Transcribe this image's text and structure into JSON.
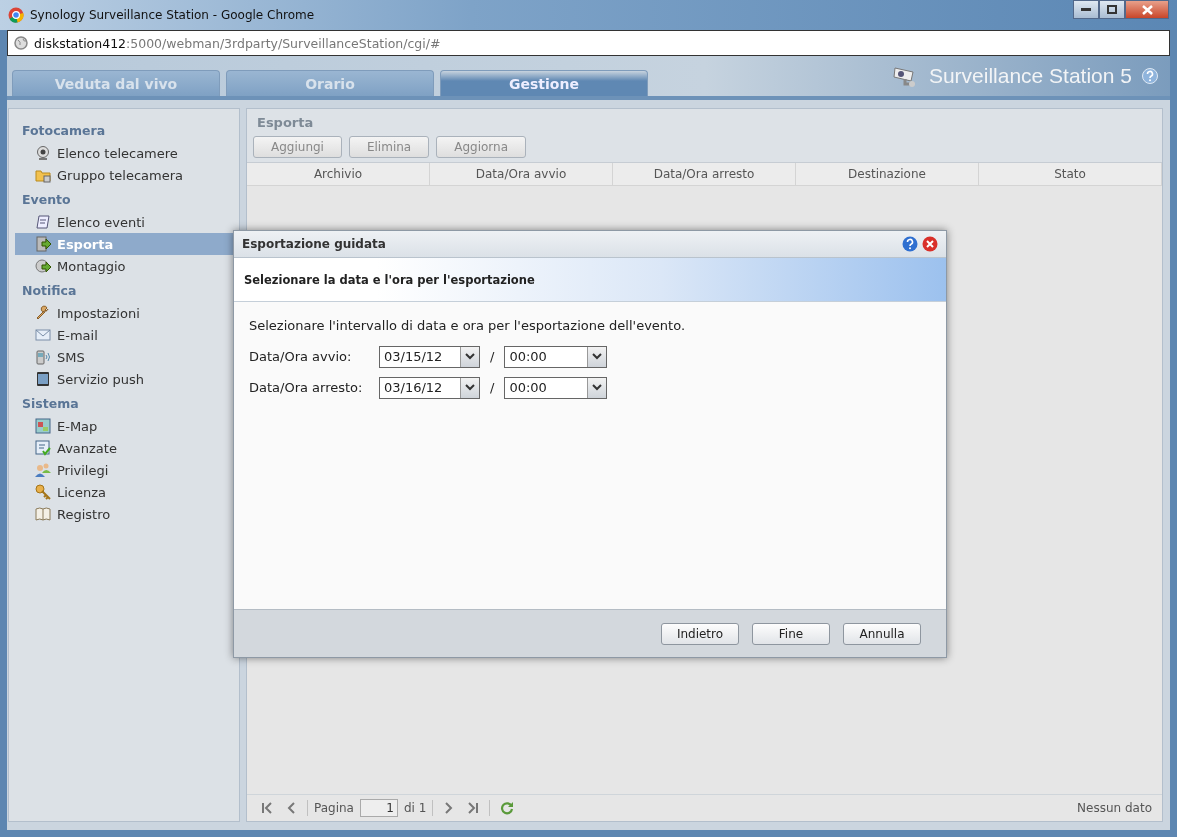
{
  "browser": {
    "title": "Synology Surveillance Station - Google Chrome",
    "url_host": "diskstation412",
    "url_rest": ":5000/webman/3rdparty/SurveillanceStation/cgi/#"
  },
  "tabs": [
    {
      "label": "Veduta dal vivo",
      "selected": false
    },
    {
      "label": "Orario",
      "selected": false
    },
    {
      "label": "Gestione",
      "selected": true
    }
  ],
  "brand": "Surveillance Station 5",
  "sidebar": {
    "groups": [
      {
        "title": "Fotocamera",
        "items": [
          {
            "label": "Elenco telecamere",
            "selected": false
          },
          {
            "label": "Gruppo telecamera",
            "selected": false
          }
        ]
      },
      {
        "title": "Evento",
        "items": [
          {
            "label": "Elenco eventi",
            "selected": false
          },
          {
            "label": "Esporta",
            "selected": true
          },
          {
            "label": "Montaggio",
            "selected": false
          }
        ]
      },
      {
        "title": "Notifica",
        "items": [
          {
            "label": "Impostazioni",
            "selected": false
          },
          {
            "label": "E-mail",
            "selected": false
          },
          {
            "label": "SMS",
            "selected": false
          },
          {
            "label": "Servizio push",
            "selected": false
          }
        ]
      },
      {
        "title": "Sistema",
        "items": [
          {
            "label": "E-Map",
            "selected": false
          },
          {
            "label": "Avanzate",
            "selected": false
          },
          {
            "label": "Privilegi",
            "selected": false
          },
          {
            "label": "Licenza",
            "selected": false
          },
          {
            "label": "Registro",
            "selected": false
          }
        ]
      }
    ]
  },
  "panel": {
    "title": "Esporta",
    "toolbar": [
      {
        "label": "Aggiungi",
        "disabled": true
      },
      {
        "label": "Elimina",
        "disabled": true
      },
      {
        "label": "Aggiorna",
        "disabled": true
      }
    ],
    "columns": [
      "Archivio",
      "Data/Ora avvio",
      "Data/Ora arresto",
      "Destinazione",
      "Stato"
    ],
    "paging": {
      "page_label": "Pagina",
      "page": "1",
      "of": "di 1",
      "status": "Nessun dato"
    }
  },
  "dialog": {
    "title": "Esportazione guidata",
    "banner": "Selezionare la data e l'ora per l'esportazione",
    "instruction": "Selezionare l'intervallo di data e ora per l'esportazione dell'evento.",
    "rows": [
      {
        "label": "Data/Ora avvio:",
        "date": "03/15/12",
        "separator": "/",
        "time": "00:00"
      },
      {
        "label": "Data/Ora arresto:",
        "date": "03/16/12",
        "separator": "/",
        "time": "00:00"
      }
    ],
    "buttons": [
      "Indietro",
      "Fine",
      "Annulla"
    ]
  }
}
